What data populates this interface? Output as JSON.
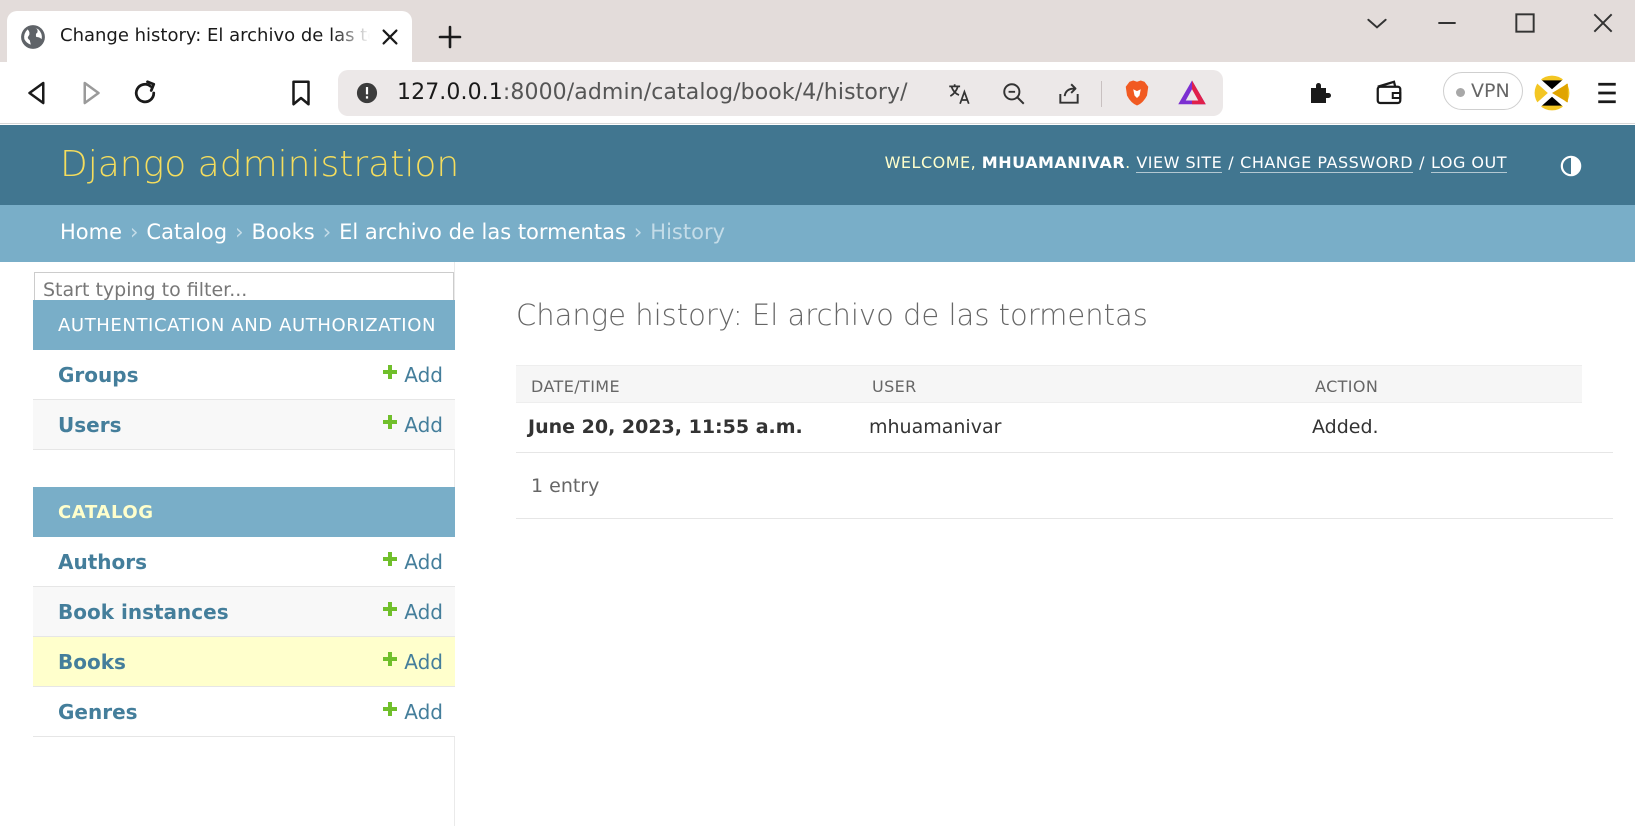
{
  "browser": {
    "tab_title": "Change history: El archivo de las tormentas",
    "url_host": "127.0.0.1",
    "url_rest": ":8000/admin/catalog/book/4/history/",
    "vpn_label": "VPN"
  },
  "header": {
    "brand": "Django administration",
    "welcome": "Welcome, ",
    "username": "mhuamanivar",
    "period": ".",
    "view_site": "View site",
    "change_password": "Change password",
    "log_out": "Log out",
    "separator": "/"
  },
  "breadcrumbs": {
    "home": "Home",
    "catalog": "Catalog",
    "books": "Books",
    "object": "El archivo de las tormentas",
    "current": "History",
    "separator": "›"
  },
  "sidebar": {
    "filter_placeholder": "Start typing to filter...",
    "add_label": "Add",
    "modules": [
      {
        "caption": "Authentication and Authorization",
        "models": [
          "Groups",
          "Users"
        ]
      },
      {
        "caption": "Catalog",
        "models": [
          "Authors",
          "Book instances",
          "Books",
          "Genres"
        ]
      }
    ]
  },
  "content": {
    "title": "Change history: El archivo de las tormentas",
    "columns": [
      "Date/time",
      "User",
      "Action"
    ],
    "rows": [
      {
        "datetime": "June 20, 2023, 11:55 a.m.",
        "user": "mhuamanivar",
        "action": "Added."
      }
    ],
    "paginator": "1 entry"
  },
  "colors": {
    "header_bg": "#417690",
    "brand": "#f5dd5d",
    "breadcrumb_bg": "#79aec8",
    "link": "#447e9b",
    "add_green": "#70bf2b",
    "current_row": "#ffffcc"
  }
}
